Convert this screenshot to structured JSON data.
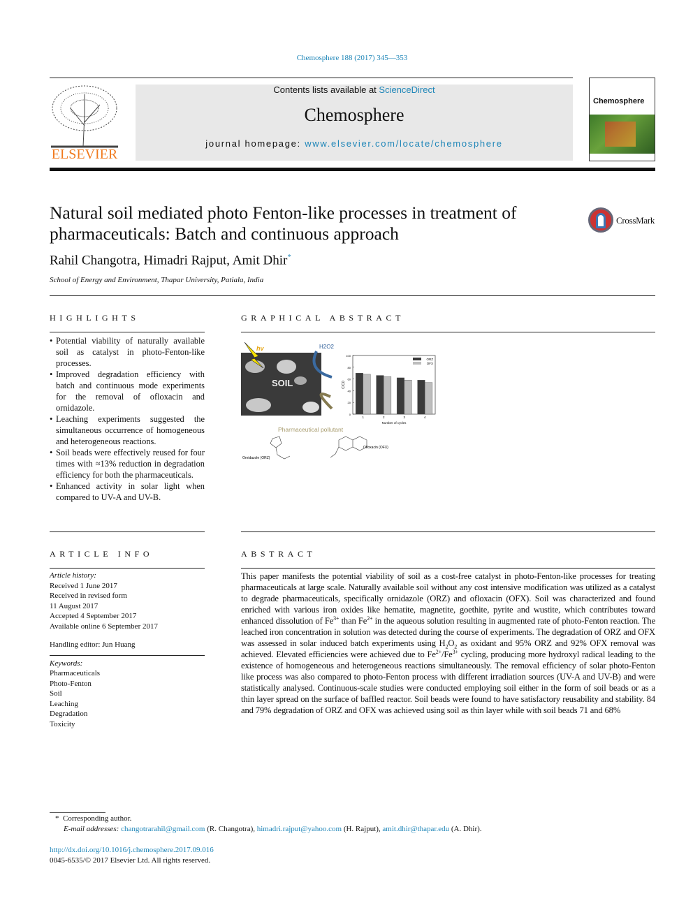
{
  "journal_ref": "Chemosphere 188 (2017) 345—353",
  "header": {
    "contents_prefix": "Contents lists available at ",
    "contents_link": "ScienceDirect",
    "journal_title": "Chemosphere",
    "homepage_prefix": "journal homepage: ",
    "homepage_url": "www.elsevier.com/locate/chemosphere",
    "publisher_logo": "ELSEVIER",
    "cover_title": "Chemosphere"
  },
  "article": {
    "title": "Natural soil mediated photo Fenton-like processes in treatment of pharmaceuticals: Batch and continuous approach",
    "crossmark": "CrossMark",
    "authors": "Rahil Changotra, Himadri Rajput, Amit Dhir",
    "author_mark": "*",
    "affiliation": "School of Energy and Environment, Thapar University, Patiala, India"
  },
  "highlights": {
    "heading": "HIGHLIGHTS",
    "items": [
      "Potential viability of naturally available soil as catalyst in photo-Fenton-like processes.",
      "Improved degradation efficiency with batch and continuous mode experiments for the removal of ofloxacin and ornidazole.",
      "Leaching experiments suggested the simultaneous occurrence of homogeneous and heterogeneous reactions.",
      "Soil beads were effectively reused for four times with ≈13% reduction in degradation efficiency for both the pharmaceuticals.",
      "Enhanced activity in solar light when compared to UV-A and UV-B."
    ]
  },
  "graphical_abstract": {
    "heading": "GRAPHICAL ABSTRACT",
    "hv": "hv",
    "h2o2": "H2O2",
    "soil": "SOIL",
    "pollutant": "Pharmaceutical pollutant",
    "ornidazole": "Ornidazole (ORZ)",
    "ofloxacin": "Ofloxacin (OFX)",
    "chart_data": {
      "type": "bar",
      "categories": [
        "1",
        "2",
        "3",
        "4"
      ],
      "xlabel": "Number of cycles",
      "ylabel": "C/C0",
      "ylim": [
        0,
        100
      ],
      "yticks": [
        0,
        20,
        40,
        60,
        80,
        100
      ],
      "legend": "top-right",
      "series": [
        {
          "name": "ORZ",
          "color": "#3a3a3a",
          "values": [
            70,
            66,
            62,
            58
          ]
        },
        {
          "name": "OFX",
          "color": "#bdbdbd",
          "values": [
            68,
            64,
            58,
            54
          ]
        }
      ]
    }
  },
  "article_info": {
    "heading": "ARTICLE INFO",
    "history_label": "Article history:",
    "history": [
      "Received 1 June 2017",
      "Received in revised form",
      "11 August 2017",
      "Accepted 4 September 2017",
      "Available online 6 September 2017"
    ],
    "editor": "Handling editor: Jun Huang",
    "keywords_label": "Keywords:",
    "keywords": [
      "Pharmaceuticals",
      "Photo-Fenton",
      "Soil",
      "Leaching",
      "Degradation",
      "Toxicity"
    ]
  },
  "abstract": {
    "heading": "ABSTRACT",
    "p1": "This paper manifests the potential viability of soil as a cost-free catalyst in photo-Fenton-like processes for treating pharmaceuticals at large scale. Naturally available soil without any cost intensive modification was utilized as a catalyst to degrade pharmaceuticals, specifically ornidazole (ORZ) and ofloxacin (OFX). Soil was characterized and found enriched with various iron oxides like hematite, magnetite, goethite, pyrite and wustite, which contributes toward enhanced dissolution of Fe",
    "sup1": "3+",
    "p2": " than Fe",
    "sup2": "2+",
    "p3": " in the aqueous solution resulting in augmented rate of photo-Fenton reaction. The leached iron concentration in solution was detected during the course of experiments. The degradation of ORZ and OFX was assessed in solar induced batch experiments using H",
    "sub1": "2",
    "p4": "O",
    "sub2": "2",
    "p5": " as oxidant and 95% ORZ and 92% OFX removal was achieved. Elevated efficiencies were achieved due to Fe",
    "sup3": "2+",
    "p6": "/Fe",
    "sup4": "3+",
    "p7": " cycling, producing more hydroxyl radical leading to the existence of homogeneous and heterogeneous reactions simultaneously. The removal efficiency of solar photo-Fenton like process was also compared to photo-Fenton process with different irradiation sources (UV-A and UV-B) and were statistically analysed. Continuous-scale studies were conducted employing soil either in the form of soil beads or as a thin layer spread on the surface of baffled reactor. Soil beads were found to have satisfactory reusability and stability. 84 and 79% degradation of ORZ and OFX was achieved using soil as thin layer while with soil beads 71 and 68%"
  },
  "footnote": {
    "mark": "*",
    "corresponding": "Corresponding author.",
    "emails_label": "E-mail addresses:",
    "email1": "changotrarahil@gmail.com",
    "name1": " (R. Changotra), ",
    "email2": "himadri.rajput@yahoo.com",
    "name2": " (H. Rajput), ",
    "email3": "amit.dhir@thapar.edu",
    "name3": " (A. Dhir).",
    "doi": "http://dx.doi.org/10.1016/j.chemosphere.2017.09.016",
    "copyright": "0045-6535/© 2017 Elsevier Ltd. All rights reserved."
  }
}
